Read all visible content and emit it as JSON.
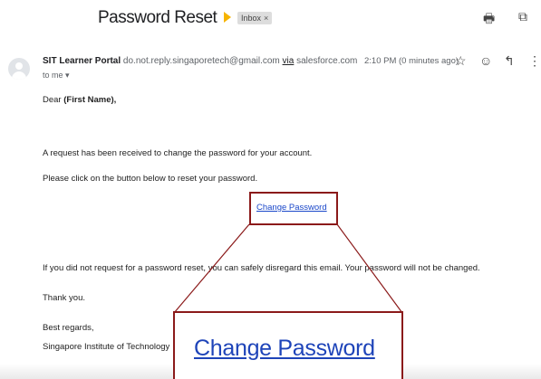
{
  "email": {
    "subject": "Password Reset",
    "label_chip": "Inbox",
    "label_chip_remove": "×",
    "sender_name": "SIT Learner Portal",
    "sender_email": "do.not.reply.singaporetech@gmail.com",
    "via_prefix": "via",
    "via_domain": "salesforce.com",
    "recipient": "to me ▾",
    "time": "2:10 PM (0 minutes ago)",
    "greeting_prefix": "Dear",
    "greeting_name": "(First Name),",
    "paragraph_1": "A request has been received to change the password for your account.",
    "paragraph_2": "Please click on the button below to reset your password.",
    "link_label": "Change Password",
    "paragraph_3": "If you did not request for a password reset, you can safely disregard this email. Your password will not be changed.",
    "thanks": "Thank you.",
    "signoff": "Best regards,",
    "signature": "Singapore Institute of Technology"
  },
  "zoom": {
    "link_label": "Change Password"
  },
  "icons": {
    "print": "🖶",
    "open_new_window": "⧉",
    "star": "☆",
    "emoji": "☺",
    "reply": "↰",
    "more": "⋮"
  },
  "colors": {
    "highlight_border": "#8b1a1a",
    "link": "#1a47c9",
    "importance": "#f6b400"
  }
}
